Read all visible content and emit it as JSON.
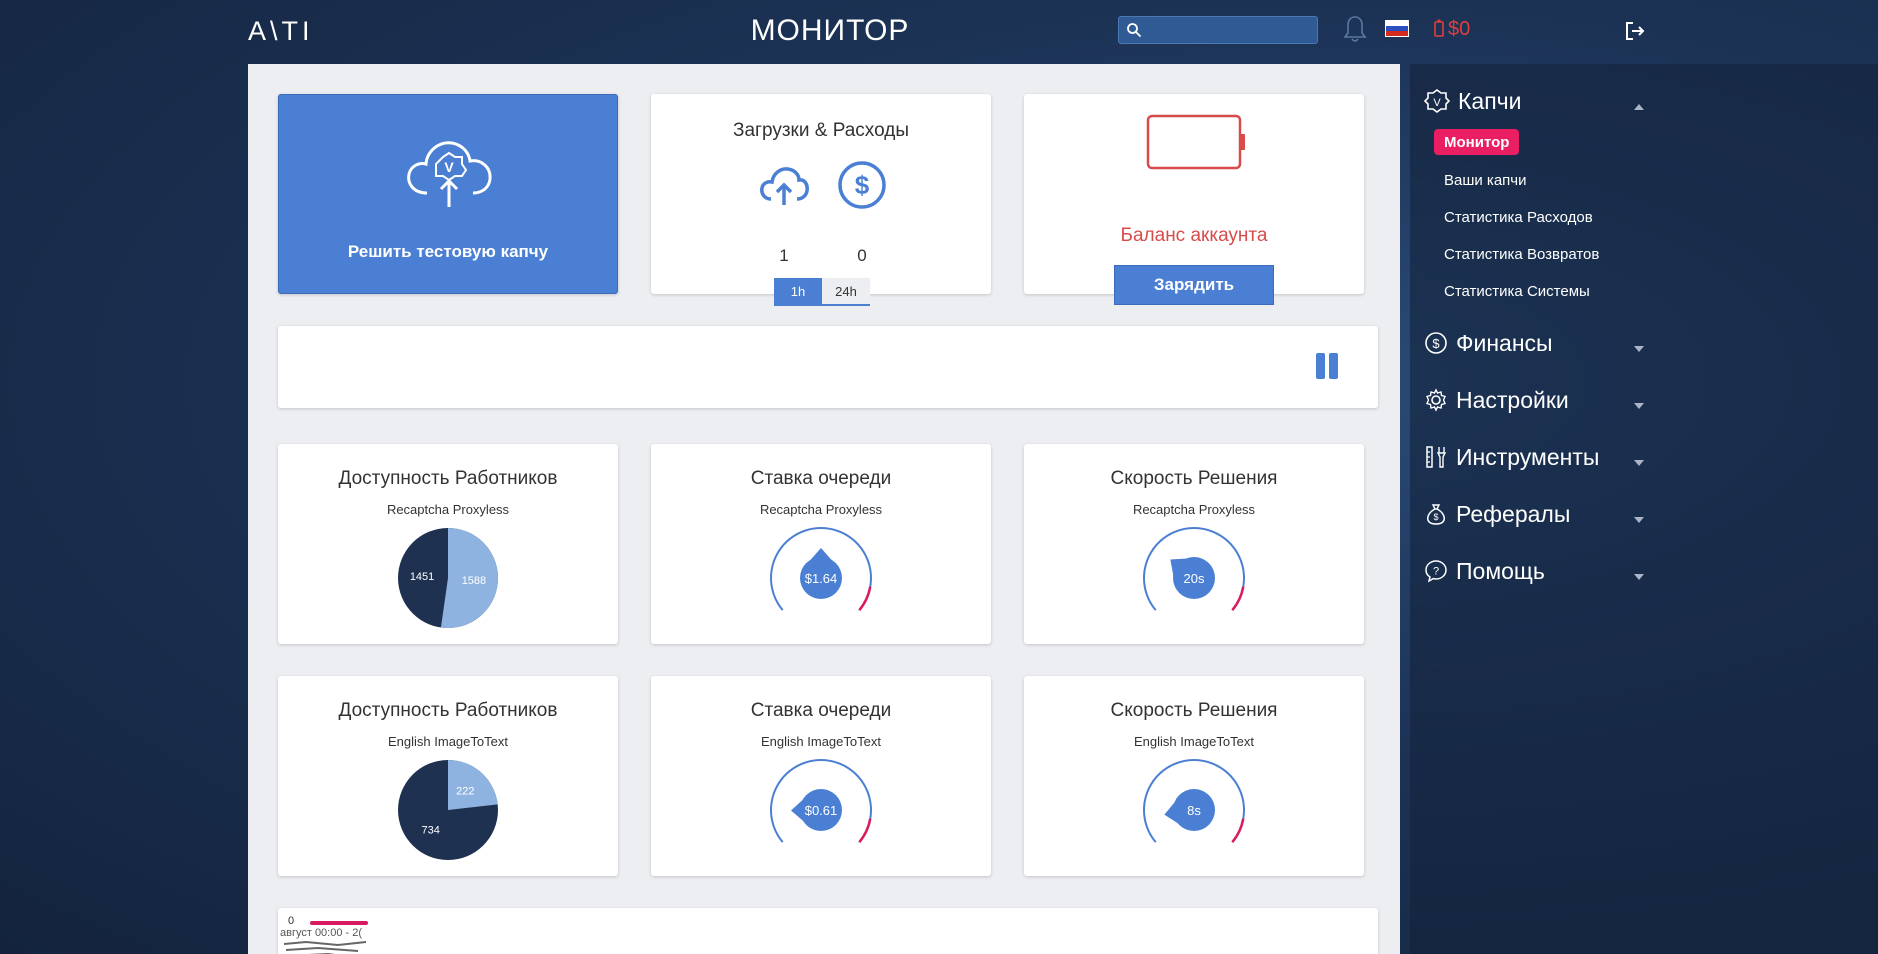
{
  "header": {
    "logo": "A\\TI",
    "title": "МОНИТОР",
    "search_placeholder": "",
    "balance": "$0"
  },
  "colors": {
    "accent": "#4a7fd4",
    "active_menu": "#e91e63",
    "balance_red": "#e23e3e",
    "pie_dark": "#1e3150",
    "pie_light": "#8fb3e0"
  },
  "icons": {
    "search": "search-icon",
    "notifications": "bell-icon",
    "language": "russian-flag-icon",
    "balance": "battery-icon",
    "logout": "logout-icon"
  },
  "top_cards": {
    "solve_test": "Решить тестовую капчу",
    "uploads_expenses": {
      "title": "Загрузки & Расходы",
      "uploads": "1",
      "expenses": "0",
      "tabs": [
        "1h",
        "24h"
      ],
      "active_tab": "1h"
    },
    "account_balance": {
      "label": "Баланс аккаунта",
      "button": "Зарядить"
    }
  },
  "stats": [
    {
      "title": "Доступность Работников",
      "subtitle": "Recaptcha Proxyless",
      "type": "pie",
      "values": [
        1451,
        1588
      ],
      "labels": [
        "1451",
        "1588"
      ]
    },
    {
      "title": "Ставка очереди",
      "subtitle": "Recaptcha Proxyless",
      "type": "gauge",
      "display": "$1.64",
      "needle_fraction": 0.5
    },
    {
      "title": "Скорость Решения",
      "subtitle": "Recaptcha Proxyless",
      "type": "gauge",
      "display": "20s",
      "needle_fraction": 0.3
    },
    {
      "title": "Доступность Работников",
      "subtitle": "English ImageToText",
      "type": "pie",
      "values": [
        734,
        222
      ],
      "labels": [
        "734",
        "222"
      ]
    },
    {
      "title": "Ставка очереди",
      "subtitle": "English ImageToText",
      "type": "gauge",
      "display": "$0.61",
      "needle_fraction": 0.15
    },
    {
      "title": "Скорость Решения",
      "subtitle": "English ImageToText",
      "type": "gauge",
      "display": "8s",
      "needle_fraction": 0.12
    }
  ],
  "bottom_chart": {
    "zero_label": "0",
    "axis_label": "август 00:00 - 2("
  },
  "sidebar": {
    "sections": [
      {
        "label": "Капчи",
        "icon": "captcha-icon",
        "expanded": true
      },
      {
        "label": "Финансы",
        "icon": "dollar-icon",
        "expanded": false
      },
      {
        "label": "Настройки",
        "icon": "gear-icon",
        "expanded": false
      },
      {
        "label": "Инструменты",
        "icon": "tools-icon",
        "expanded": false
      },
      {
        "label": "Рефералы",
        "icon": "moneybag-icon",
        "expanded": false
      },
      {
        "label": "Помощь",
        "icon": "help-icon",
        "expanded": false
      }
    ],
    "captcha_items": [
      {
        "label": "Монитор",
        "active": true
      },
      {
        "label": "Ваши капчи",
        "active": false
      },
      {
        "label": "Статистика Расходов",
        "active": false
      },
      {
        "label": "Статистика Возвратов",
        "active": false
      },
      {
        "label": "Статистика Системы",
        "active": false
      }
    ]
  }
}
